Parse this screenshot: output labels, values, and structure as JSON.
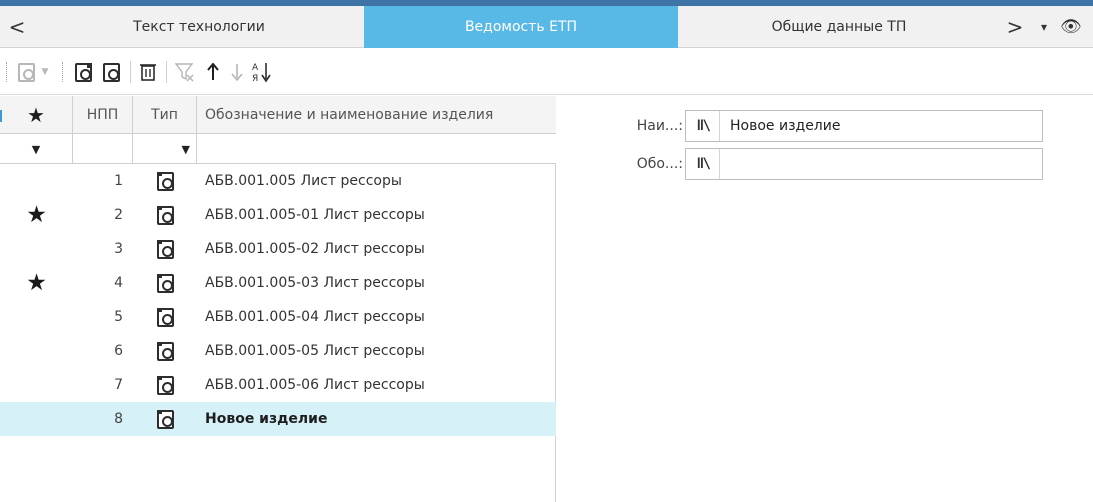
{
  "tabs": {
    "prev_icon": "chevron-left-icon",
    "prev_glyph": "<",
    "items": [
      {
        "label": "Текст технологии"
      },
      {
        "label": "Ведомость ЕТП"
      },
      {
        "label": "Общие данные ТП"
      }
    ],
    "active_index": 1,
    "next_icon": "chevron-right-icon",
    "next_glyph": ">",
    "menu_glyph": "▾",
    "eye_glyph": "👁"
  },
  "toolbar": {
    "sort_label": "А↓Я"
  },
  "grid": {
    "headers": {
      "star": "★",
      "npp": "НПП",
      "type": "Тип",
      "name": "Обозначение и наименование изделия"
    },
    "filter_arrow": "▼",
    "rows": [
      {
        "starred": "",
        "npp": "1",
        "name": "АБВ.001.005 Лист рессоры"
      },
      {
        "starred": "★",
        "npp": "2",
        "name": "АБВ.001.005-01 Лист рессоры"
      },
      {
        "starred": "",
        "npp": "3",
        "name": "АБВ.001.005-02 Лист рессоры"
      },
      {
        "starred": "★",
        "npp": "4",
        "name": "АБВ.001.005-03 Лист рессоры"
      },
      {
        "starred": "",
        "npp": "5",
        "name": "АБВ.001.005-04 Лист рессоры"
      },
      {
        "starred": "",
        "npp": "6",
        "name": "АБВ.001.005-05 Лист рессоры"
      },
      {
        "starred": "",
        "npp": "7",
        "name": "АБВ.001.005-06 Лист рессоры"
      },
      {
        "starred": "",
        "npp": "8",
        "name": "Новое изделие"
      }
    ],
    "selected_index": 7
  },
  "properties": {
    "fields": [
      {
        "label": "Наи...:",
        "icon_glyph": "ǁ\\",
        "value": "Новое изделие"
      },
      {
        "label": "Обо...:",
        "icon_glyph": "ǁ\\",
        "value": ""
      }
    ]
  },
  "colors": {
    "active_tab": "#59b9e6",
    "selected_row": "#d7f1f9",
    "top_line": "#3f75a6"
  }
}
